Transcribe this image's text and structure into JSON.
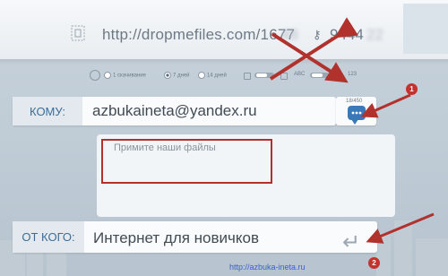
{
  "top": {
    "link_main": "http://dropmefiles.com/1677",
    "link_blur": "48",
    "pass_main": "9444",
    "pass_blur": "22"
  },
  "options": {
    "one_download": "1 скачивание",
    "seven_days": "7 дней",
    "fourteen_days": "14 дней",
    "abc": "ABC",
    "numbers": "123"
  },
  "recipient": {
    "label": "КОМУ:",
    "value": "azbukaineta@yandex.ru",
    "counter": "18/450"
  },
  "message": {
    "placeholder": "Примите наши файлы"
  },
  "sender": {
    "label": "ОТ КОГО:",
    "value": "Интернет для новичков"
  },
  "annotations": {
    "badge1": "1",
    "badge2": "2"
  },
  "footer": {
    "link": "http://azbuka-ineta.ru"
  },
  "colors": {
    "accent": "#3d6d97",
    "annotation_red": "#b1312c",
    "bg": "#c8d3dc"
  },
  "icons": {
    "file": "file-icon",
    "key": "key-icon",
    "contact": "contact-icon",
    "return": "return-icon"
  }
}
